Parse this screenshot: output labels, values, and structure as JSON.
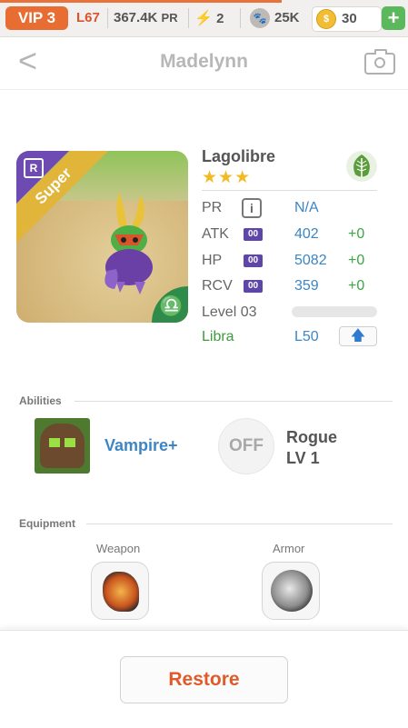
{
  "topbar": {
    "vip": "VIP 3",
    "level": "L67",
    "power": "367.4K",
    "power_unit": "PR",
    "energy": "2",
    "paws": "25K",
    "coins": "30",
    "add_label": "+"
  },
  "header": {
    "back_glyph": "<",
    "title": "Madelynn"
  },
  "monster": {
    "rarity_badge": "R",
    "tier": "Super",
    "name": "Lagolibre",
    "stars": "★★★",
    "zodiac_glyph": "♎",
    "element_icon": "leaf-icon"
  },
  "stats": {
    "pr_label": "PR",
    "pr_info": "i",
    "pr_value": "N/A",
    "atk_label": "ATK",
    "atk_badge": "00",
    "atk_value": "402",
    "atk_bonus": "+0",
    "hp_label": "HP",
    "hp_badge": "00",
    "hp_value": "5082",
    "hp_bonus": "+0",
    "rcv_label": "RCV",
    "rcv_badge": "00",
    "rcv_value": "359",
    "rcv_bonus": "+0",
    "level_label": "Level 03",
    "level_progress": 0,
    "zodiac_label": "Libra",
    "zodiac_level": "L50",
    "upgrade_glyph": "🡅"
  },
  "abilities": {
    "section": "Abilities",
    "ability1": "Vampire+",
    "ability2_state": "OFF",
    "ability2_name": "Rogue",
    "ability2_level": "LV 1"
  },
  "equipment": {
    "section": "Equipment",
    "weapon_label": "Weapon",
    "armor_label": "Armor"
  },
  "footer": {
    "restore_label": "Restore"
  },
  "colors": {
    "accent_orange": "#e86d33",
    "stat_blue": "#3a86c6",
    "bonus_green": "#3aa843",
    "tier_gold": "#e1b43a"
  }
}
